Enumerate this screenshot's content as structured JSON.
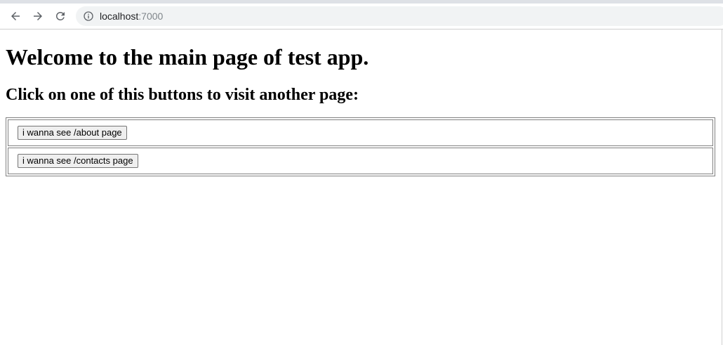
{
  "browser": {
    "url_host": "localhost",
    "url_port": ":7000",
    "icons": {
      "back": "arrow-left-icon",
      "forward": "arrow-right-icon",
      "reload": "reload-icon",
      "info": "info-circle-icon"
    }
  },
  "page": {
    "heading": "Welcome to the main page of test app.",
    "subheading": "Click on one of this buttons to visit another page:",
    "buttons": [
      {
        "label": "i wanna see /about page"
      },
      {
        "label": "i wanna see /contacts page"
      }
    ]
  }
}
